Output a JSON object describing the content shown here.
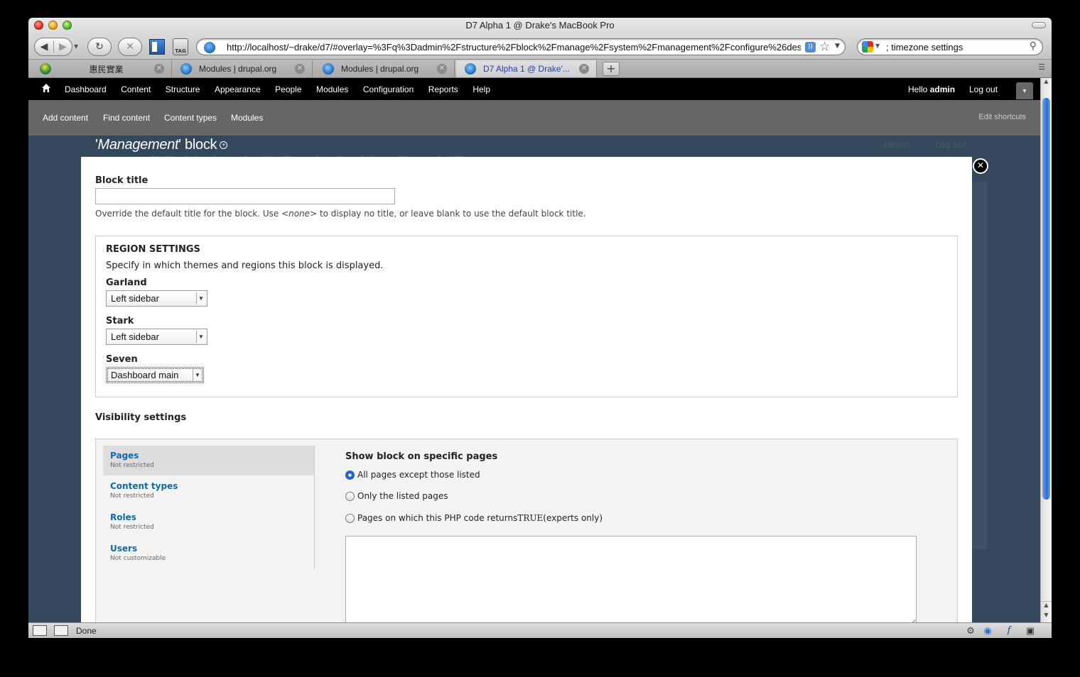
{
  "window": {
    "title": "D7 Alpha 1 @ Drake's MacBook Pro"
  },
  "browser": {
    "url": "http://localhost/~drake/d7/#overlay=%3Fq%3Dadmin%2Fstructure%2Fblock%2Fmanage%2Fsystem%2Fmanagement%2Fconfigure%26destir",
    "search_value": "; timezone settings",
    "tag_label": "TAG",
    "tabs": [
      {
        "label": "惠民實業"
      },
      {
        "label": "Modules | drupal.org"
      },
      {
        "label": "Modules | drupal.org"
      },
      {
        "label": "D7 Alpha 1 @ Drake'..."
      }
    ]
  },
  "toolbar": {
    "menu": [
      "Dashboard",
      "Content",
      "Structure",
      "Appearance",
      "People",
      "Modules",
      "Configuration",
      "Reports",
      "Help"
    ],
    "hello_prefix": "Hello ",
    "user": "admin",
    "logout": "Log out"
  },
  "shortcuts": {
    "items": [
      "Add content",
      "Find content",
      "Content types",
      "Modules"
    ],
    "edit": "Edit shortcuts"
  },
  "background": {
    "ghost_title": "D7 Alpha 1 @ Drake's MacBook Pro",
    "admin": "admin",
    "logout": "Log out"
  },
  "overlay": {
    "title_quote_open": "'",
    "title_em": "Management",
    "title_rest": "' block",
    "block_title_label": "Block title",
    "block_title_value": "",
    "block_title_desc_1": "Override the default title for the block. Use ",
    "block_title_desc_em": "<none>",
    "block_title_desc_2": " to display no title, or leave blank to use the default block title.",
    "region_legend": "REGION SETTINGS",
    "region_desc": "Specify in which themes and regions this block is displayed.",
    "themes": [
      {
        "label": "Garland",
        "value": "Left sidebar"
      },
      {
        "label": "Stark",
        "value": "Left sidebar"
      },
      {
        "label": "Seven",
        "value": "Dashboard main"
      }
    ],
    "visibility_label": "Visibility settings",
    "vtabs": [
      {
        "title": "Pages",
        "summary": "Not restricted"
      },
      {
        "title": "Content types",
        "summary": "Not restricted"
      },
      {
        "title": "Roles",
        "summary": "Not restricted"
      },
      {
        "title": "Users",
        "summary": "Not customizable"
      }
    ],
    "pages_title": "Show block on specific pages",
    "radio_1": "All pages except those listed",
    "radio_2": "Only the listed pages",
    "radio_3_a": "Pages on which this PHP code returns ",
    "radio_3_code": "TRUE",
    "radio_3_b": " (experts only)",
    "pages_value": ""
  },
  "status": {
    "text": "Done"
  },
  "colors": {
    "toolbar": "#000000",
    "shortcuts": "#666666",
    "backdrop": "#35475a",
    "link": "#0e6aae"
  }
}
